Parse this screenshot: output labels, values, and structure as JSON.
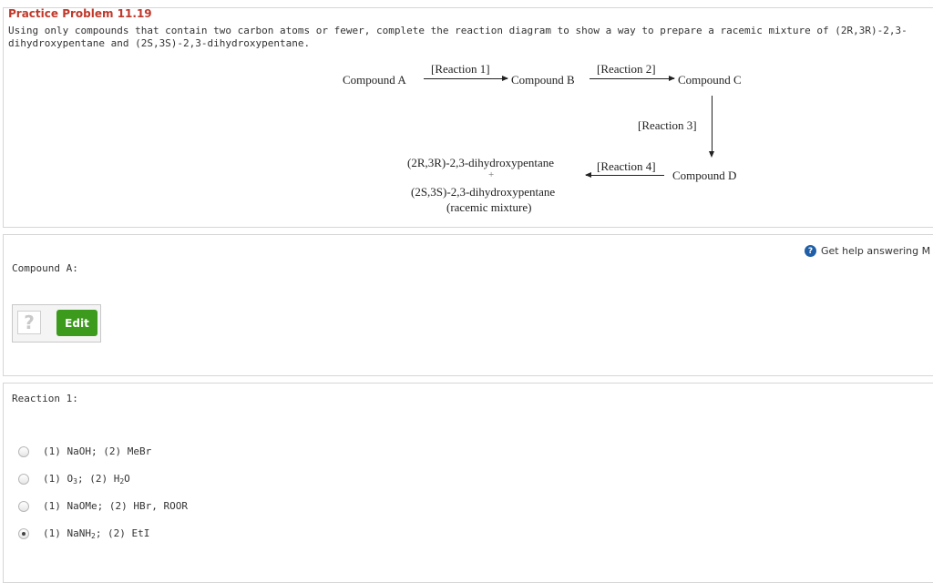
{
  "problem": {
    "title": "Practice Problem 11.19",
    "description": "Using only compounds that contain two carbon atoms or fewer, complete the reaction diagram to show a way to prepare a racemic mixture of (2R,3R)-2,3-dihydroxypentane and (2S,3S)-2,3-dihydroxypentane."
  },
  "diagram": {
    "compound_a": "Compound A",
    "compound_b": "Compound B",
    "compound_c": "Compound C",
    "compound_d": "Compound D",
    "reaction_1": "[Reaction 1]",
    "reaction_2": "[Reaction 2]",
    "reaction_3": "[Reaction 3]",
    "reaction_4": "[Reaction 4]",
    "product_1": "(2R,3R)-2,3-dihydroxypentane",
    "plus": "+",
    "product_2": "(2S,3S)-2,3-dihydroxypentane",
    "product_note": "(racemic mixture)"
  },
  "help": {
    "label": "Get help answering M"
  },
  "compound_a_section": {
    "label": "Compound A:",
    "placeholder_glyph": "?",
    "edit_label": "Edit"
  },
  "reaction1_section": {
    "label": "Reaction 1:",
    "options": [
      {
        "parts": [
          "(1) NaOH; (2) MeBr"
        ],
        "selected": false
      },
      {
        "parts": [
          "(1) O",
          "3",
          "; (2) H",
          "2",
          "O"
        ],
        "selected": false
      },
      {
        "parts": [
          "(1) NaOMe; (2) HBr, ROOR"
        ],
        "selected": false
      },
      {
        "parts": [
          "(1) NaNH",
          "2",
          "; (2) EtI"
        ],
        "selected": true
      }
    ]
  }
}
